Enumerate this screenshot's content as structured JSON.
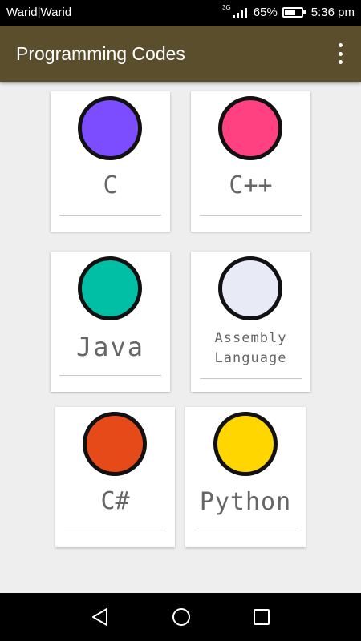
{
  "status_bar": {
    "carrier": "Warid|Warid",
    "network": "3G",
    "battery_percent": "65%",
    "battery_level": 0.65,
    "time": "5:36 pm"
  },
  "app_bar": {
    "title": "Programming Codes",
    "overflow_icon": "more-vert-icon"
  },
  "languages": [
    {
      "label": "C",
      "color": "#7c4dff"
    },
    {
      "label": "C++",
      "color": "#ff4081"
    },
    {
      "label": "Java",
      "color": "#00bfa5"
    },
    {
      "label": "Assembly Language",
      "color": "#e8eaf6"
    },
    {
      "label": "C#",
      "color": "#e64a19"
    },
    {
      "label": "Python",
      "color": "#ffd600"
    }
  ],
  "nav_bar": {
    "back_icon": "back-triangle-icon",
    "home_icon": "home-circle-icon",
    "recents_icon": "recents-square-icon"
  }
}
